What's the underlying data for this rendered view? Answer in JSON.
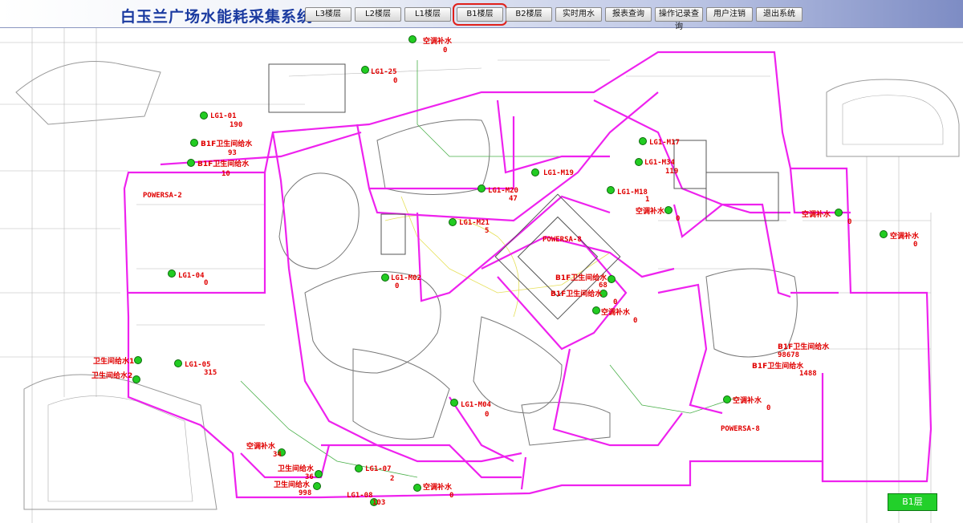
{
  "app": {
    "title": "白玉兰广场水能耗采集系统"
  },
  "nav": [
    {
      "label": "L3楼层"
    },
    {
      "label": "L2楼层"
    },
    {
      "label": "L1楼层"
    },
    {
      "label": "B1楼层",
      "active": true
    },
    {
      "label": "B2楼层"
    },
    {
      "label": "实时用水"
    },
    {
      "label": "报表查询"
    },
    {
      "label": "操作记录查询"
    },
    {
      "label": "用户注销"
    },
    {
      "label": "退出系统"
    }
  ],
  "colors": {
    "label": "#e00000",
    "meter": "#22cc22",
    "pipe": "#ee22ee",
    "active_outline": "#e0201a",
    "badge": "#22d02a"
  },
  "meters": [
    {
      "name": "空调补水",
      "value": "0"
    },
    {
      "name": "LG1-25",
      "value": "0"
    },
    {
      "name": "LG1-01",
      "value": "190"
    },
    {
      "name": "B1F卫生间给水",
      "value": "93"
    },
    {
      "name": "B1F卫生间给水",
      "value": "10"
    },
    {
      "name": "LG1-M17",
      "value": ""
    },
    {
      "name": "LG1-M34",
      "value": "119"
    },
    {
      "name": "LG1-M19",
      "value": ""
    },
    {
      "name": "LG1-M20",
      "value": "47"
    },
    {
      "name": "LG1-M18",
      "value": "1"
    },
    {
      "name": "空调补水",
      "value": "0"
    },
    {
      "name": "空调补水",
      "value": "0"
    },
    {
      "name": "空调补水",
      "value": "0"
    },
    {
      "name": "LG1-M21",
      "value": "5"
    },
    {
      "name": "LG1-04",
      "value": "0"
    },
    {
      "name": "LG1-M02",
      "value": "0"
    },
    {
      "name": "B1F卫生间给水",
      "value": "68"
    },
    {
      "name": "B1F卫生间给水",
      "value": "0"
    },
    {
      "name": "空调补水",
      "value": "0"
    },
    {
      "name": "B1F卫生间给水",
      "value": "98678"
    },
    {
      "name": "B1F卫生间给水",
      "value": "1488"
    },
    {
      "name": "卫生间给水1",
      "value": ""
    },
    {
      "name": "卫生间给水2",
      "value": ""
    },
    {
      "name": "LG1-05",
      "value": "315"
    },
    {
      "name": "LG1-M04",
      "value": "0"
    },
    {
      "name": "空调补水",
      "value": "0"
    },
    {
      "name": "空调补水",
      "value": "34"
    },
    {
      "name": "卫生间给水",
      "value": "36"
    },
    {
      "name": "卫生间给水",
      "value": "998"
    },
    {
      "name": "LG1-07",
      "value": "2"
    },
    {
      "name": "LG1-08",
      "value": "103"
    },
    {
      "name": "空调补水",
      "value": "0"
    }
  ],
  "power_labels": [
    "POWERSA-2",
    "POWERSA-8",
    "POWERSA-8"
  ],
  "floor_badge": "B1层"
}
